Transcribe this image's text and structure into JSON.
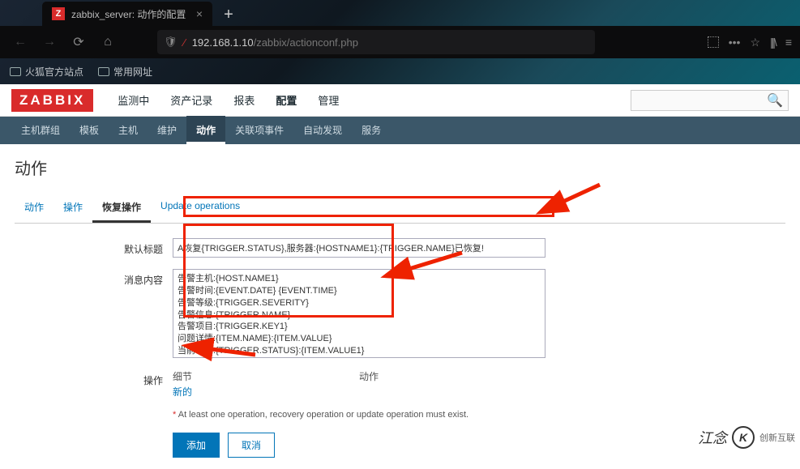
{
  "browser": {
    "tab_favicon_letter": "Z",
    "tab_title": "zabbix_server: 动作的配置",
    "url_host": "192.168.1.10",
    "url_path": "/zabbix/actionconf.php",
    "bookmarks": [
      "火狐官方站点",
      "常用网址"
    ]
  },
  "zabbix": {
    "logo": "ZABBIX",
    "top_menu": [
      "监测中",
      "资产记录",
      "报表",
      "配置",
      "管理"
    ],
    "top_menu_active": "配置",
    "sub_menu": [
      "主机群组",
      "模板",
      "主机",
      "维护",
      "动作",
      "关联项事件",
      "自动发现",
      "服务"
    ],
    "sub_menu_active": "动作"
  },
  "page": {
    "title": "动作",
    "tabs": [
      "动作",
      "操作",
      "恢复操作",
      "Update operations"
    ],
    "tabs_active": "恢复操作",
    "form": {
      "label_subject": "默认标题",
      "subject_value": "A恢复{TRIGGER.STATUS},服务器:{HOSTNAME1}:{TRIGGER.NAME}已恢复!",
      "label_message": "消息内容",
      "message_value": "告警主机:{HOST.NAME1}\n告警时间:{EVENT.DATE} {EVENT.TIME}\n告警等级:{TRIGGER.SEVERITY}\n告警信息:{TRIGGER.NAME}\n告警项目:{TRIGGER.KEY1}\n问题详情:{ITEM.NAME}:{ITEM.VALUE}\n当前状态:{TRIGGER.STATUS}:{ITEM.VALUE1}",
      "label_ops": "操作",
      "ops_col_detail": "细节",
      "ops_col_action": "动作",
      "ops_new": "新的",
      "warning": "At least one operation, recovery operation or update operation must exist.",
      "btn_add": "添加",
      "btn_cancel": "取消"
    }
  },
  "watermark": {
    "text": "江念",
    "brand": "创新互联"
  }
}
